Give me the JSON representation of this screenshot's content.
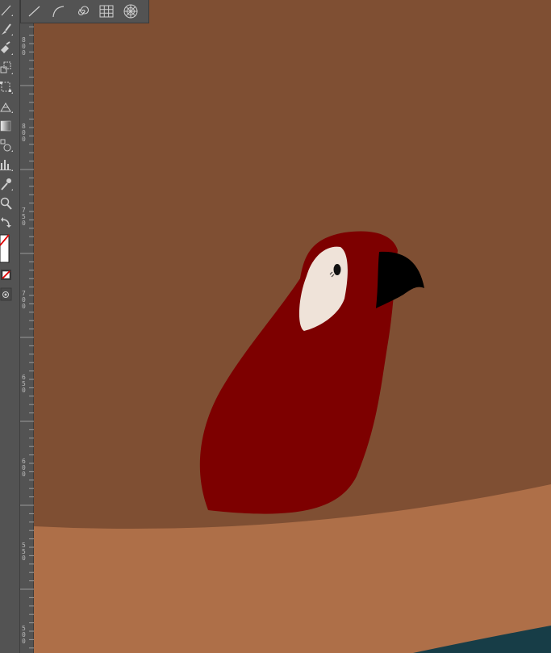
{
  "app": {
    "canvas_colors": {
      "background": "#7f4f33",
      "ground": "#ae6f48",
      "water": "#173d47",
      "parrot_body": "#7d0000",
      "face_patch": "#efe3d9",
      "beak": "#000000"
    }
  },
  "toolbar": {
    "tools": [
      {
        "name": "line-segment-tool",
        "icon": "line-icon"
      },
      {
        "name": "paintbrush-tool",
        "icon": "brush-icon"
      },
      {
        "name": "shaper-tool",
        "icon": "pencil-icon"
      },
      {
        "name": "scale-tool",
        "icon": "scale-icon"
      },
      {
        "name": "free-transform-tool",
        "icon": "transform-icon"
      },
      {
        "name": "perspective-grid-tool",
        "icon": "perspective-icon"
      },
      {
        "name": "gradient-tool",
        "icon": "gradient-icon"
      },
      {
        "name": "blend-tool",
        "icon": "shapes-icon"
      },
      {
        "name": "column-graph-tool",
        "icon": "graph-icon"
      },
      {
        "name": "eyedropper-tool",
        "icon": "eyedropper-icon"
      },
      {
        "name": "zoom-tool",
        "icon": "zoom-icon"
      },
      {
        "name": "swap-fill-stroke",
        "icon": "swap-icon"
      },
      {
        "name": "fill-stroke-swatch",
        "icon": "fill-stroke-icon"
      },
      {
        "name": "none-swatch",
        "icon": "none-icon"
      },
      {
        "name": "draw-mode",
        "icon": "draw-mode-icon"
      }
    ]
  },
  "flyout": {
    "tools": [
      {
        "name": "line-segment",
        "icon": "line-segment-icon"
      },
      {
        "name": "arc",
        "icon": "arc-icon"
      },
      {
        "name": "spiral",
        "icon": "spiral-icon"
      },
      {
        "name": "rectangular-grid",
        "icon": "rectangular-grid-icon"
      },
      {
        "name": "polar-grid",
        "icon": "polar-grid-icon"
      }
    ]
  },
  "ruler": {
    "labels": [
      "800",
      "800",
      "750",
      "700",
      "650",
      "600",
      "550",
      "500"
    ]
  }
}
